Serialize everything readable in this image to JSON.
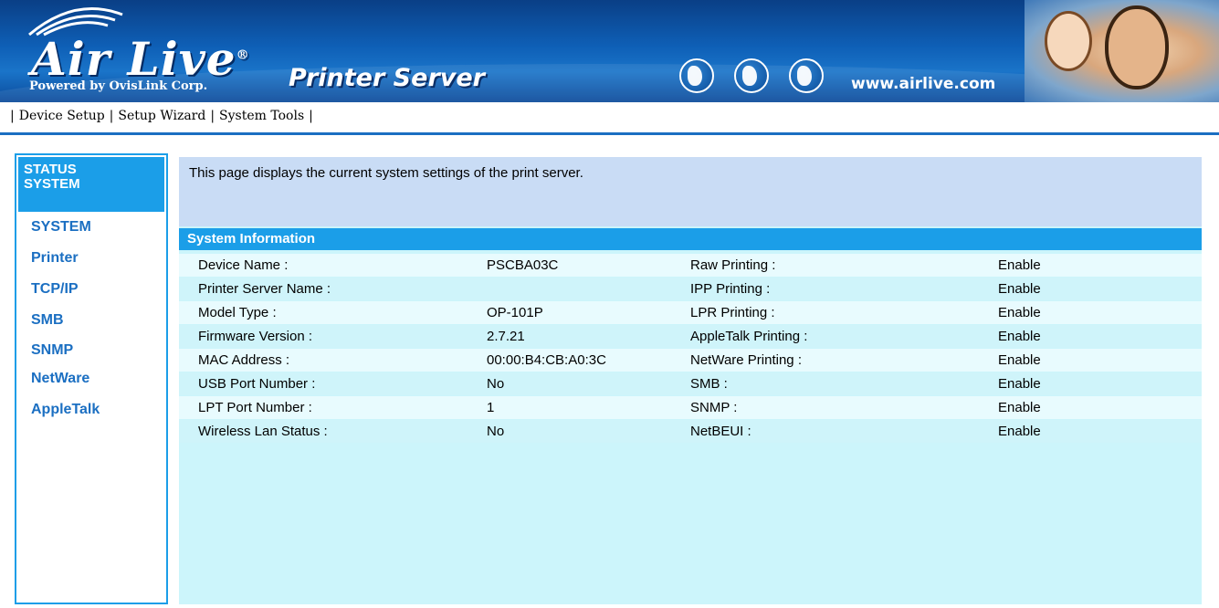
{
  "header": {
    "logo_text": "Air Live",
    "logo_registered": "®",
    "logo_subtitle": "Powered by OvisLink Corp.",
    "product_title": "Printer Server",
    "site_url": "www.airlive.com",
    "icons": [
      "globe-icon",
      "globe-icon",
      "globe-icon"
    ]
  },
  "nav": {
    "items": [
      {
        "label": "Device Setup"
      },
      {
        "label": "Setup Wizard"
      },
      {
        "label": "System Tools"
      }
    ],
    "separator": "|"
  },
  "sidebar": {
    "header_line1": "STATUS",
    "header_line2": "SYSTEM",
    "items": [
      {
        "label": "SYSTEM"
      },
      {
        "label": "Printer"
      },
      {
        "label": "TCP/IP"
      },
      {
        "label": "SMB"
      },
      {
        "label": "SNMP"
      },
      {
        "label": "NetWare"
      },
      {
        "label": "AppleTalk"
      }
    ]
  },
  "main": {
    "description": "This page displays the current system settings of the print server.",
    "section_title": "System Information",
    "rows": [
      {
        "label1": "Device Name :",
        "value1": "PSCBA03C",
        "label2": "Raw Printing :",
        "value2": "Enable"
      },
      {
        "label1": "Printer Server Name :",
        "value1": "",
        "label2": "IPP Printing :",
        "value2": "Enable"
      },
      {
        "label1": "Model Type :",
        "value1": "OP-101P",
        "label2": "LPR Printing :",
        "value2": "Enable"
      },
      {
        "label1": "Firmware Version :",
        "value1": "2.7.21",
        "label2": "AppleTalk Printing :",
        "value2": "Enable"
      },
      {
        "label1": "MAC Address :",
        "value1": "00:00:B4:CB:A0:3C",
        "label2": "NetWare Printing :",
        "value2": "Enable"
      },
      {
        "label1": "USB Port Number :",
        "value1": "No",
        "label2": "SMB :",
        "value2": "Enable"
      },
      {
        "label1": "LPT Port Number :",
        "value1": "1",
        "label2": "SNMP :",
        "value2": "Enable"
      },
      {
        "label1": "Wireless Lan Status :",
        "value1": "No",
        "label2": "NetBEUI :",
        "value2": "Enable"
      }
    ]
  },
  "colors": {
    "banner_blue": "#0e5fb6",
    "accent": "#1b9ee8",
    "link": "#1b6fc2",
    "panel_bg": "#ccf5fb",
    "desc_bg": "#c9dcf5"
  }
}
